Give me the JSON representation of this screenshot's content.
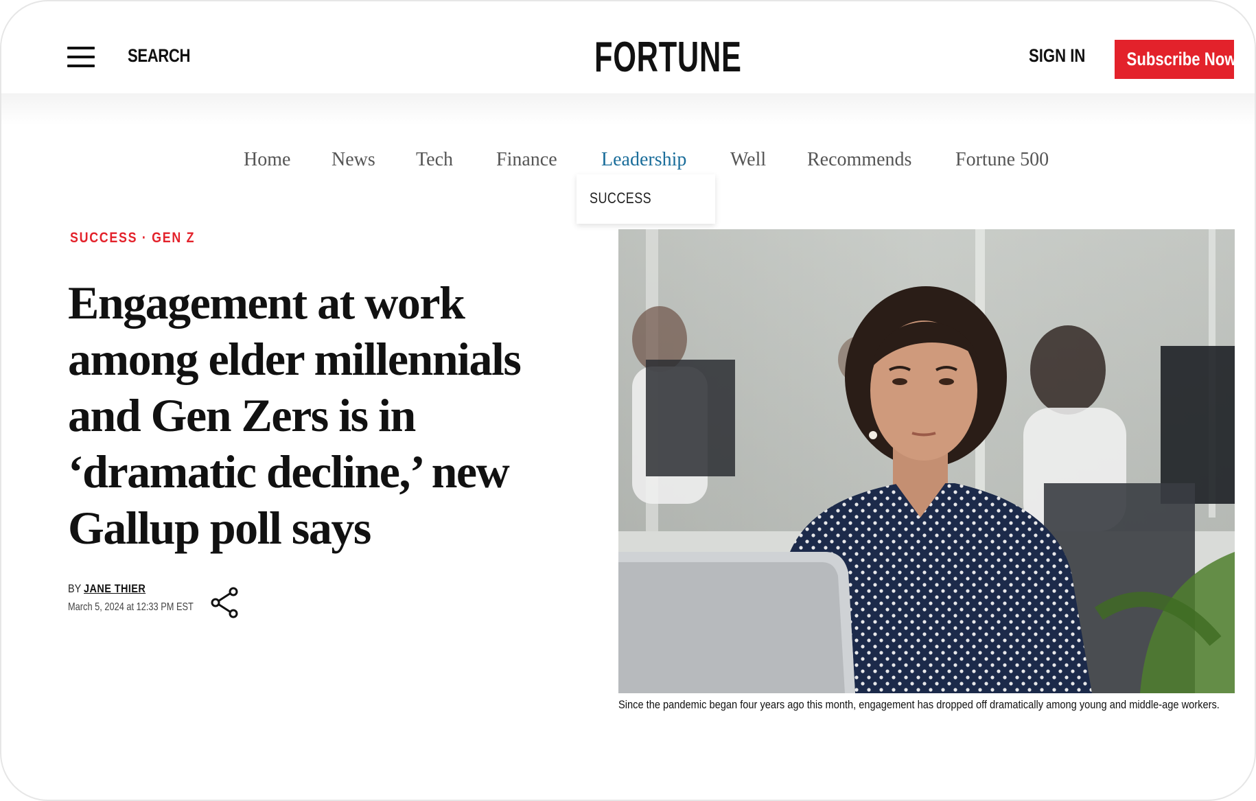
{
  "header": {
    "search_label": "SEARCH",
    "logo_text": "FORTUNE",
    "signin_label": "SIGN IN",
    "subscribe_label": "Subscribe Now",
    "accent_color": "#e3222b"
  },
  "nav": {
    "items": [
      {
        "label": "Home"
      },
      {
        "label": "News"
      },
      {
        "label": "Tech"
      },
      {
        "label": "Finance"
      },
      {
        "label": "Leadership",
        "active": true
      },
      {
        "label": "Well"
      },
      {
        "label": "Recommends"
      },
      {
        "label": "Fortune 500"
      }
    ],
    "active_color": "#1a6d9a",
    "dropdown": {
      "items": [
        {
          "label": "SUCCESS"
        }
      ]
    }
  },
  "article": {
    "tags": [
      "SUCCESS",
      "GEN Z"
    ],
    "tag_separator": " · ",
    "headline": "Engagement at work among elder millennials and Gen Zers is in ‘dramatic decline,’ new Gallup poll says",
    "byline_prefix": "BY",
    "author": "JANE THIER",
    "date": "March 5, 2024 at 12:33 PM EST",
    "image_caption": "Since the pandemic began four years ago this month, engagement has dropped off dramatically among young and middle-age workers."
  },
  "icons": {
    "menu": "hamburger-menu-icon",
    "share": "share-icon"
  }
}
